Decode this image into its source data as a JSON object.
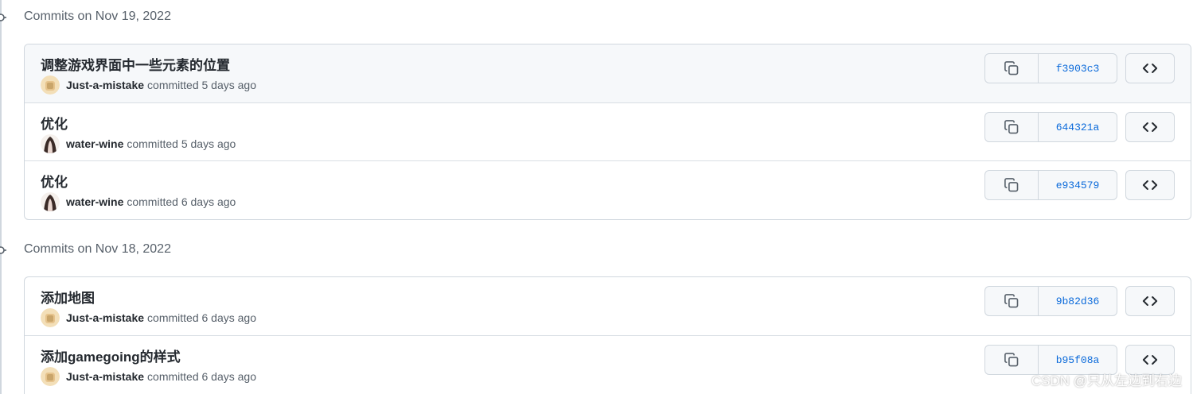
{
  "groups": [
    {
      "title": "Commits on Nov 19, 2022",
      "commits": [
        {
          "message": "调整游戏界面中一些元素的位置",
          "author": "Just-a-mistake",
          "meta": "committed 5 days ago",
          "sha": "f3903c3",
          "avatar": "avatar-just-a-mistake"
        },
        {
          "message": "优化",
          "author": "water-wine",
          "meta": "committed 5 days ago",
          "sha": "644321a",
          "avatar": "avatar-water-wine"
        },
        {
          "message": "优化",
          "author": "water-wine",
          "meta": "committed 6 days ago",
          "sha": "e934579",
          "avatar": "avatar-water-wine"
        }
      ]
    },
    {
      "title": "Commits on Nov 18, 2022",
      "commits": [
        {
          "message": "添加地图",
          "author": "Just-a-mistake",
          "meta": "committed 6 days ago",
          "sha": "9b82d36",
          "avatar": "avatar-just-a-mistake"
        },
        {
          "message": "添加gamegoing的样式",
          "author": "Just-a-mistake",
          "meta": "committed 6 days ago",
          "sha": "b95f08a",
          "avatar": "avatar-just-a-mistake"
        }
      ]
    }
  ],
  "icons": {
    "commit_node": "git-commit-icon",
    "copy": "copy-icon",
    "browse": "code-icon"
  },
  "colors": {
    "sha_link": "#0969da",
    "muted_text": "#57606a",
    "border": "#d0d7de",
    "row_highlight": "#f6f8fa"
  },
  "watermark": "CSDN @只从左边到右边"
}
